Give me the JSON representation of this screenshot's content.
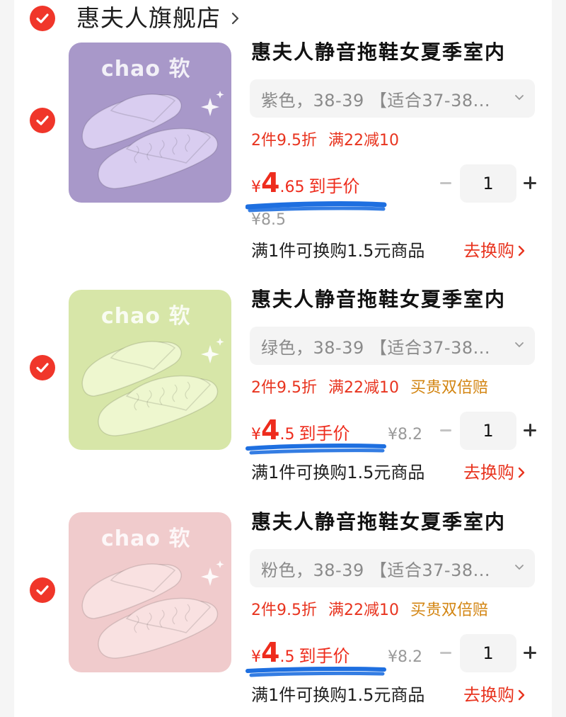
{
  "store": {
    "name": "惠夫人旗舰店"
  },
  "items": [
    {
      "thumb_text": "chao 软",
      "title": "惠夫人静音拖鞋女夏季室内",
      "sku": "紫色，38-39 【适合37-38...",
      "promos": [
        "2件9.5折",
        "满22减10"
      ],
      "gold_promo": "",
      "price_yen": "¥",
      "price_major": "4",
      "price_minor": ".65",
      "price_label": "到手价",
      "orig_price": "¥8.5",
      "quantity": "1",
      "swap_text": "满1件可换购1.5元商品",
      "swap_link": "去换购",
      "bg_color": "#a898c9",
      "shoe_color": "#d9cdf0"
    },
    {
      "thumb_text": "chao 软",
      "title": "惠夫人静音拖鞋女夏季室内",
      "sku": "绿色，38-39 【适合37-38...",
      "promos": [
        "2件9.5折",
        "满22减10"
      ],
      "gold_promo": "买贵双倍赔",
      "price_yen": "¥",
      "price_major": "4",
      "price_minor": ".5",
      "price_label": "到手价",
      "orig_price": "¥8.2",
      "quantity": "1",
      "swap_text": "满1件可换购1.5元商品",
      "swap_link": "去换购",
      "bg_color": "#d7e6a8",
      "shoe_color": "#eef7cf"
    },
    {
      "thumb_text": "chao 软",
      "title": "惠夫人静音拖鞋女夏季室内",
      "sku": "粉色，38-39 【适合37-38...",
      "promos": [
        "2件9.5折",
        "满22减10"
      ],
      "gold_promo": "买贵双倍赔",
      "price_yen": "¥",
      "price_major": "4",
      "price_minor": ".5",
      "price_label": "到手价",
      "orig_price": "¥8.2",
      "quantity": "1",
      "swap_text": "满1件可换购1.5元商品",
      "swap_link": "去换购",
      "bg_color": "#f0cbcc",
      "shoe_color": "#f9e1e1"
    }
  ],
  "colors": {
    "accent_red": "#f0362a",
    "price_red": "#ee2c1d",
    "gold": "#d38512",
    "highlight_blue": "#1e6fe0"
  },
  "icons": {
    "check": "check-circle-icon",
    "chevron": "chevron-right-icon",
    "caret": "chevron-down-icon",
    "minus": "minus-icon",
    "plus": "plus-icon"
  }
}
